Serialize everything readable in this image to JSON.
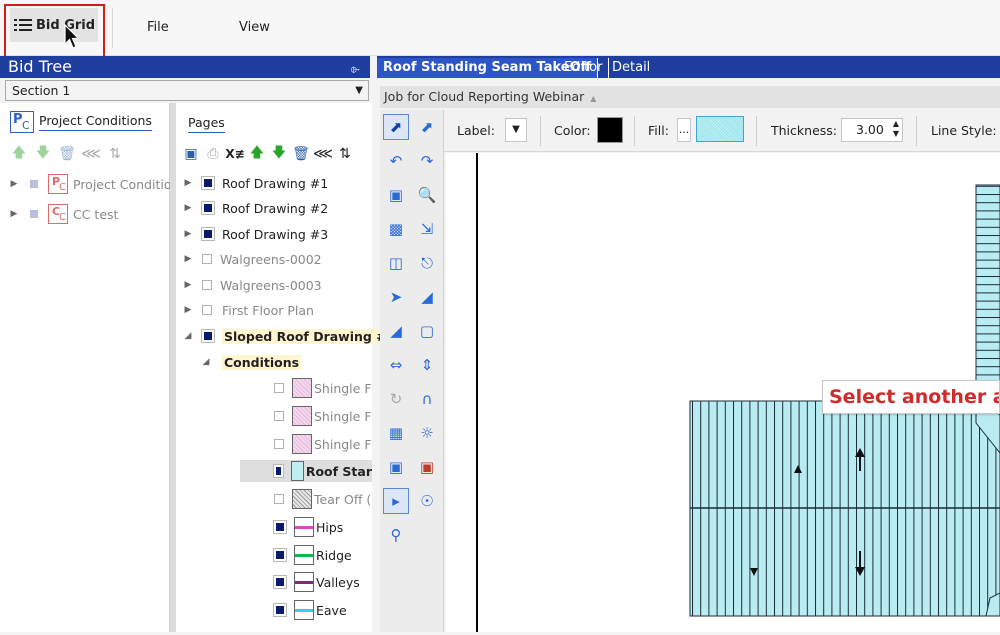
{
  "ribbon": {
    "bid_grid_label": "Bid Grid",
    "file_label": "File",
    "view_label": "View"
  },
  "bid_tree": {
    "title": "Bid Tree",
    "pin": "⌱",
    "section": "Section 1",
    "project_conditions_header": "Project Conditions",
    "items": [
      {
        "label": "Project Conditio",
        "badge": "PC"
      },
      {
        "label": "CC test",
        "badge": "CC"
      }
    ]
  },
  "pages": {
    "header": "Pages",
    "rows": [
      {
        "label": "Roof Drawing #1",
        "checked": true
      },
      {
        "label": "Roof Drawing #2",
        "checked": true
      },
      {
        "label": "Roof Drawing #3",
        "checked": true
      },
      {
        "label": "Walgreens-0002",
        "checked": false
      },
      {
        "label": "Walgreens-0003",
        "checked": false
      },
      {
        "label": "First Floor Plan",
        "checked": false
      },
      {
        "label": "Sloped Roof Drawing #",
        "checked": true
      }
    ],
    "conditions_label": "Conditions",
    "conditions": [
      {
        "label": "Shingle F",
        "checked": false,
        "color": "#f3d8ee"
      },
      {
        "label": "Shingle F",
        "checked": false,
        "color": "#f3d8ee"
      },
      {
        "label": "Shingle F",
        "checked": false,
        "color": "#f3d8ee"
      },
      {
        "label": "Roof Star",
        "checked": true,
        "color": "#bfeff3"
      },
      {
        "label": "Tear Off (",
        "checked": false,
        "color": "#e6e6e6"
      },
      {
        "label": "Hips",
        "checked": true,
        "color": "#e046c2"
      },
      {
        "label": "Ridge",
        "checked": true,
        "color": "#19b14b"
      },
      {
        "label": "Valleys",
        "checked": true,
        "color": "#7a2a7a"
      },
      {
        "label": "Eave",
        "checked": true,
        "color": "#36d0e6"
      }
    ]
  },
  "doc_tabs": {
    "active": "Roof Standing Seam TakeOff",
    "editor": "Editor",
    "detail": "Detail"
  },
  "job": {
    "title": "Job for Cloud Reporting Webinar"
  },
  "props": {
    "label_lbl": "Label:",
    "color_lbl": "Color:",
    "fill_lbl": "Fill:",
    "fill_dots": "...",
    "thickness_lbl": "Thickness:",
    "thickness_val": "3.00",
    "line_style_lbl": "Line Style:"
  },
  "canvas": {
    "tooltip": "Select another a"
  }
}
